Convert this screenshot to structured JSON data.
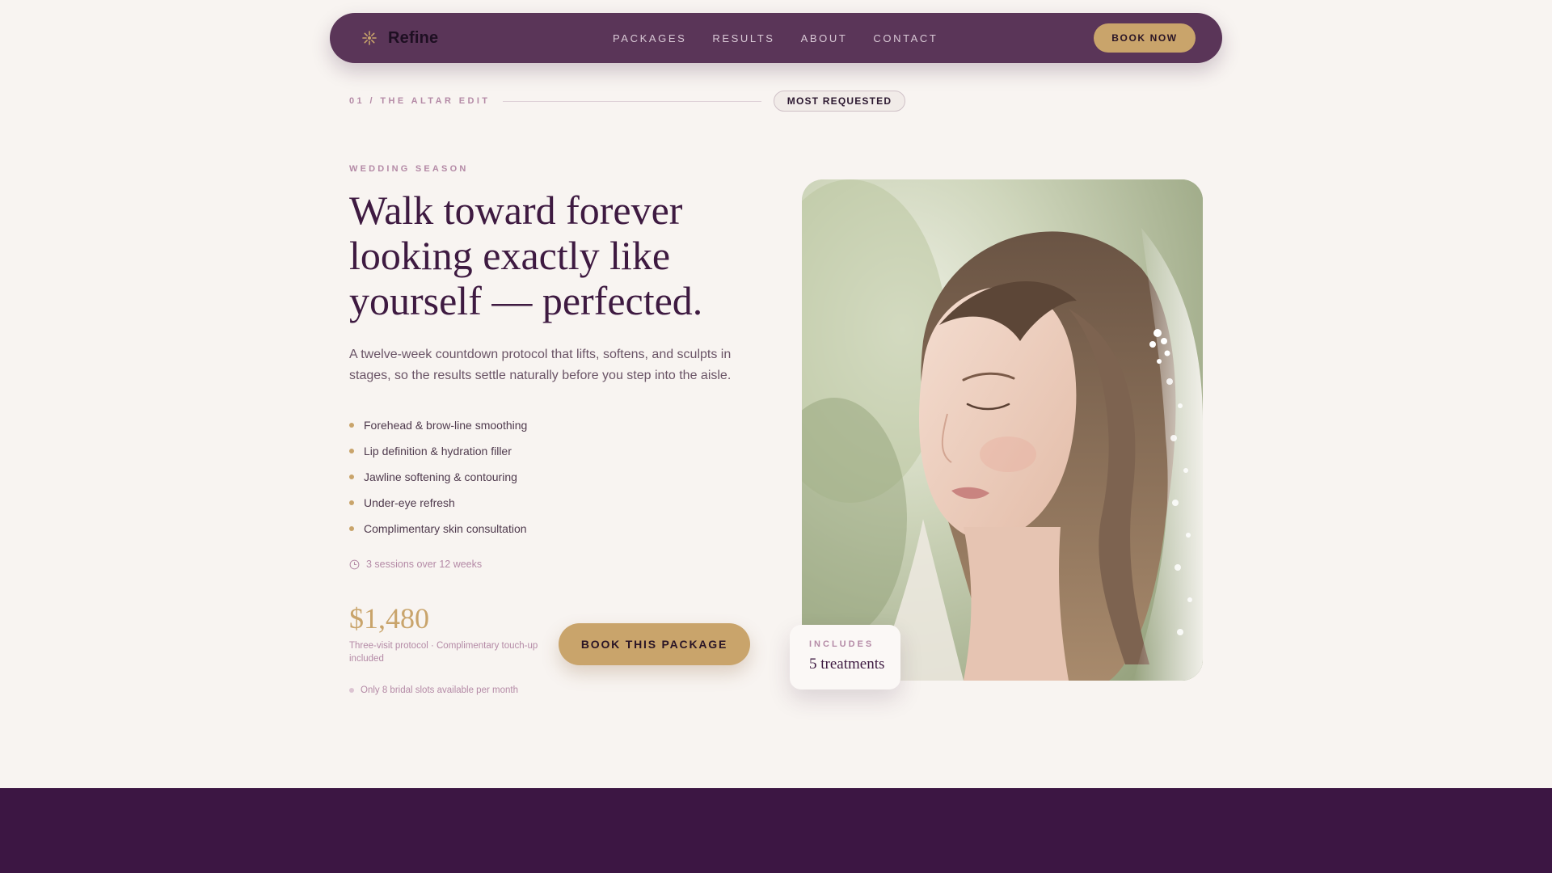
{
  "nav": {
    "brand": "Refine",
    "links": [
      "PACKAGES",
      "RESULTS",
      "ABOUT",
      "CONTACT"
    ],
    "cta": "BOOK NOW"
  },
  "section": {
    "eyebrow": "01 / THE ALTAR EDIT",
    "badge": "MOST REQUESTED"
  },
  "hero": {
    "kicker": "WEDDING SEASON",
    "headline": "Walk toward forever looking exactly like yourself — perfected.",
    "lede": "A twelve-week countdown protocol that lifts, softens, and sculpts in stages, so the results settle naturally before you step into the aisle.",
    "features": [
      "Forehead & brow-line smoothing",
      "Lip definition & hydration filler",
      "Jawline softening & contouring",
      "Under-eye refresh",
      "Complimentary skin consultation"
    ],
    "duration": "3 sessions over 12 weeks",
    "price": "$1,480",
    "price_note": "Three-visit protocol · Complimentary touch-up included",
    "scarcity": "Only 8 bridal slots available per month",
    "cta": "BOOK THIS PACKAGE"
  },
  "includes": {
    "label": "INCLUDES",
    "value": "5 treatments"
  },
  "colors": {
    "nav_bg": "#5a3558",
    "accent_gold": "#c9a46b",
    "plum": "#3e1a41",
    "page_bg": "#f8f4f1",
    "footer_bg": "#3c1643"
  }
}
